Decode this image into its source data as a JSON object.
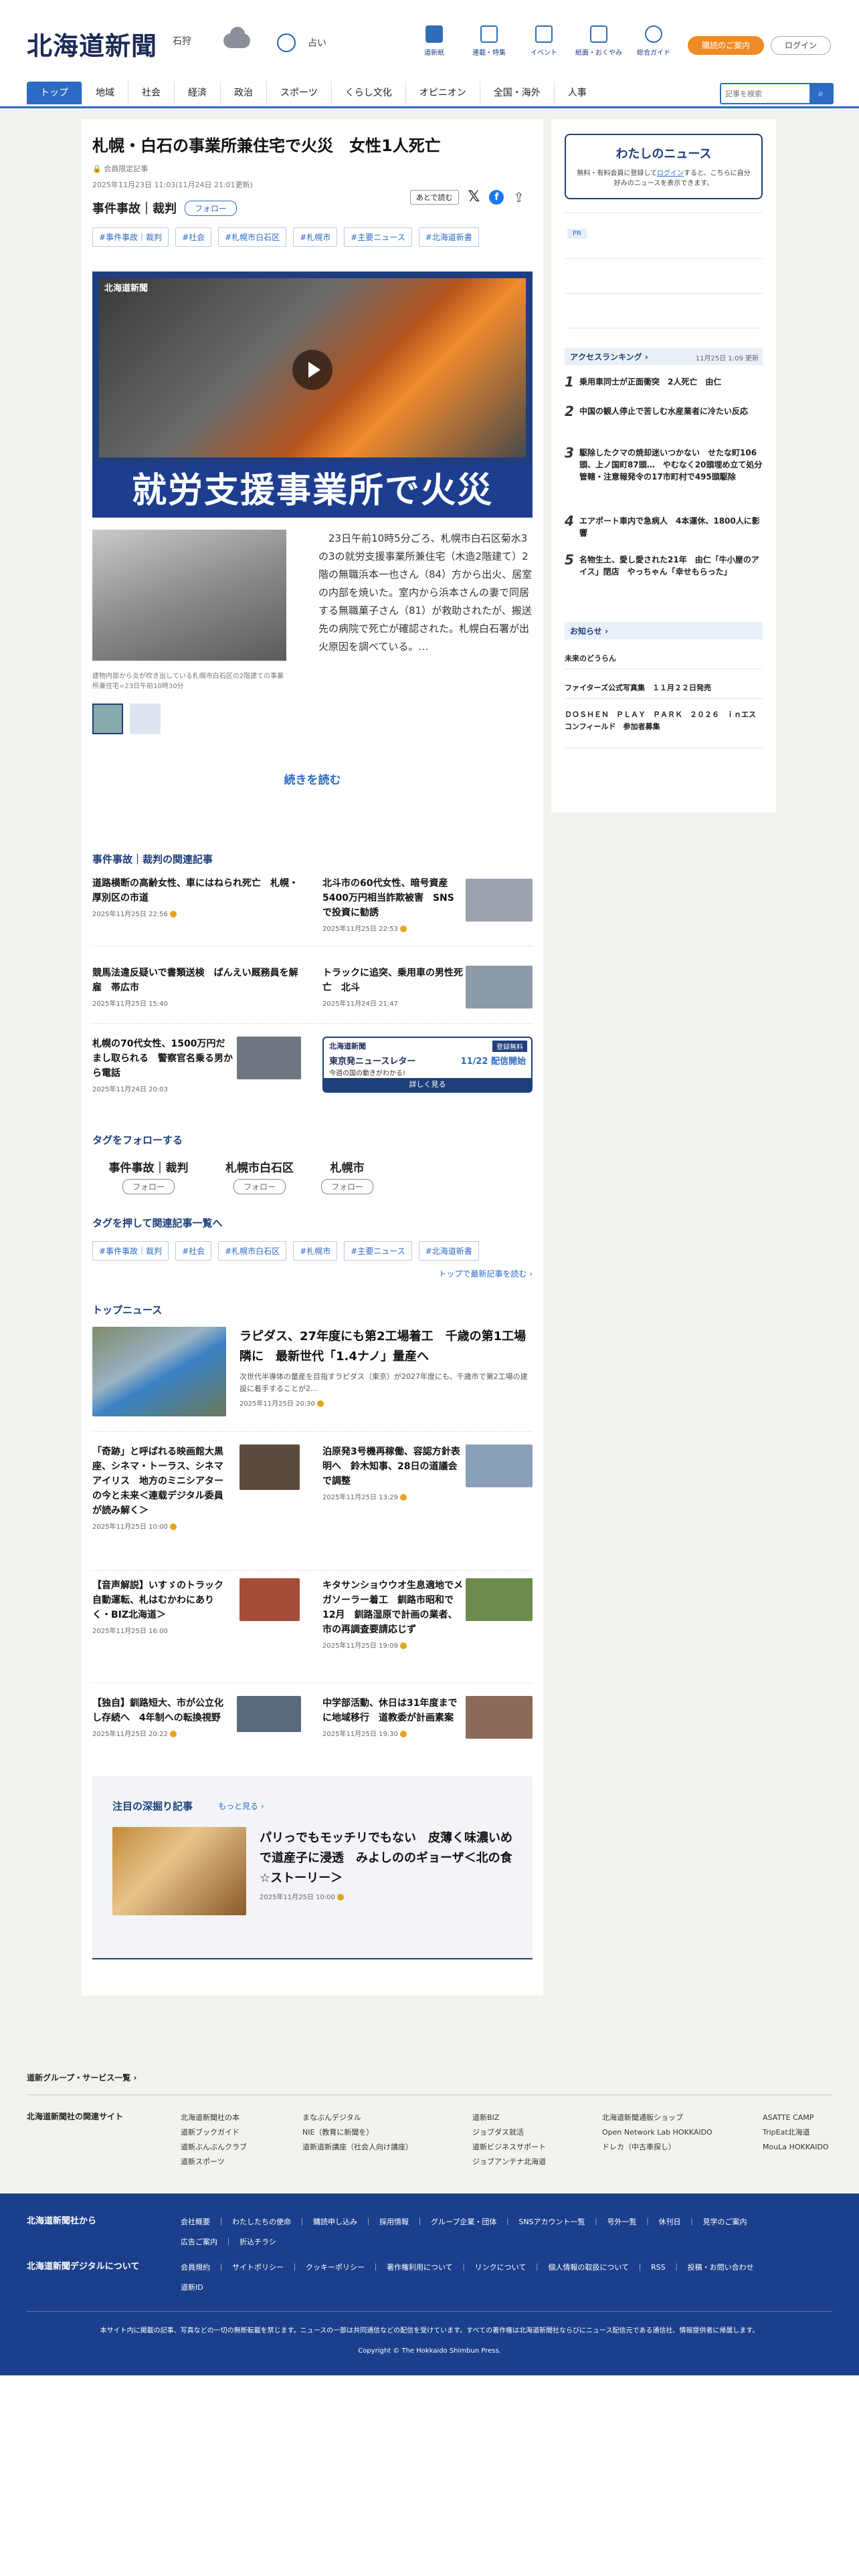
{
  "header": {
    "logo": "北海道新聞",
    "region": "石狩",
    "weather_label": "占い",
    "icons": [
      {
        "icon": "book-icon",
        "label": "道新紙"
      },
      {
        "icon": "flag-icon",
        "label": "連載・特集"
      },
      {
        "icon": "calendar-icon",
        "label": "イベント"
      },
      {
        "icon": "newspaper-icon",
        "label": "紙面・おくやみ"
      },
      {
        "icon": "help-icon",
        "label": "総合ガイド"
      }
    ],
    "subscribe": "購読のご案内",
    "login": "ログイン"
  },
  "nav": {
    "items": [
      "トップ",
      "地域",
      "社会",
      "経済",
      "政治",
      "スポーツ",
      "くらし文化",
      "オピニオン",
      "全国・海外",
      "人事"
    ],
    "search_placeholder": "記事を検索"
  },
  "article": {
    "title": "札幌・白石の事業所兼住宅で火災　女性1人死亡",
    "badge": "会員限定記事",
    "date": "2025年11月23日 11:03(11月24日 21:01更新)",
    "category": "事件事故｜裁判",
    "follow": "フォロー",
    "read_later": "あとで読む",
    "tags": [
      "#事件事故｜裁判",
      "#社会",
      "#札幌市白石区",
      "#札幌市",
      "#主要ニュース",
      "#北海道新書"
    ],
    "video_logo": "北海道新聞",
    "video_caption": "就労支援事業所で火災",
    "photo_caption": "建物内部から炎が吹き出している札幌市白石区の2階建ての事業所兼住宅=23日午前10時30分",
    "body": "23日午前10時5分ごろ、札幌市白石区菊水3の3の就労支援事業所兼住宅（木造2階建て）2階の無職浜本一也さん（84）方から出火、居室の内部を焼いた。室内から浜本さんの妻で同居する無職菓子さん（81）が救助されたが、搬送先の病院で死亡が確認された。札幌白石署が出火原因を調べている。…",
    "continue": "続きを読む"
  },
  "related": {
    "heading": "事件事故｜裁判の関連記事",
    "items": [
      {
        "t": "道路横断の高齢女性、車にはねられ死亡　札幌・厚別区の市道",
        "d": "2025年11月25日 22:56"
      },
      {
        "t": "北斗市の60代女性、暗号資産5400万円相当詐欺被害　SNSで投資に勧誘",
        "d": "2025年11月25日 22:53"
      },
      {
        "t": "競馬法違反疑いで書類送検　ばんえい厩務員を解雇　帯広市",
        "d": "2025年11月25日 15:40"
      },
      {
        "t": "トラックに追突、乗用車の男性死亡　北斗",
        "d": "2025年11月24日 21:47"
      },
      {
        "t": "札幌の70代女性、1500万円だまし取られる　警察官名乗る男から電話",
        "d": "2025年11月24日 20:03"
      }
    ],
    "promo": {
      "logo": "北海道新聞",
      "badge": "登録無料",
      "line1": "東京発ニュースレター",
      "line2": "11/22 配信開始",
      "line3": "今週の国の動きがわかる!",
      "cta": "詳しく見る"
    }
  },
  "follow_tags": {
    "heading": "タグをフォローする",
    "items": [
      "事件事故｜裁判",
      "札幌市白石区",
      "札幌市"
    ],
    "button": "フォロー"
  },
  "tag_search": {
    "heading": "タグを押して関連記事一覧へ",
    "tags": [
      "#事件事故｜裁判",
      "#社会",
      "#札幌市白石区",
      "#札幌市",
      "#主要ニュース",
      "#北海道新書"
    ],
    "more": "トップで最新記事を読む"
  },
  "top": {
    "heading": "トップニュース",
    "lead": {
      "t": "ラピダス、27年度にも第2工場着工　千歳の第1工場隣に　最新世代「1.4ナノ」量産へ",
      "s": "次世代半導体の量産を目指すラピダス（東京）が2027年度にも、千歳市で第2工場の建設に着手することが2…",
      "d": "2025年11月25日 20:30"
    },
    "items": [
      {
        "t": "「奇跡」と呼ばれる映画館大黒座、シネマ・トーラス、シネマアイリス　地方のミニシアターの今と未来＜連载デジタル委員が読み解く＞",
        "d": "2025年11月25日 10:00"
      },
      {
        "t": "泊原発3号機再稼働、容認方針表明へ　鈴木知事、28日の道議会で調整",
        "d": "2025年11月25日 13:29"
      },
      {
        "t": "【音声解説】いすゞのトラック自動運転、札はむかわにありく・BIZ北海道＞",
        "d": "2025年11月25日 16:00"
      },
      {
        "t": "キタサンショウウオ生息適地でメガソーラー着工　釧路市昭和で12月　釧路湿原で計画の業者、市の再調査要請応じず",
        "d": "2025年11月25日 19:09"
      },
      {
        "t": "【独自】釧路短大、市が公立化し存続へ　4年制への転換視野",
        "d": "2025年11月25日 20:22"
      },
      {
        "t": "中学部活動、休日は31年度までに地域移行　道教委が計画素案",
        "d": "2025年11月25日 19:30"
      }
    ]
  },
  "deep": {
    "heading": "注目の深掘り記事",
    "more": "もっと見る",
    "t": "パリっでもモッチリでもない　皮薄く味濃いめで道産子に浸透　みよしののギョーザ＜北の食☆ストーリー＞",
    "d": "2025年11月25日 10:00"
  },
  "side": {
    "mynews_title": "わたしのニュース",
    "mynews_text": "無料・有料会員に登録して",
    "mynews_login": "ログイン",
    "mynews_text2": "すると、こちらに自分好みのニュースを表示できます。",
    "pr": "PR",
    "ranking_title": "アクセスランキング",
    "ranking_time": "11月25日 1:09 更新",
    "ranking": [
      "乗用車同士が正面衝突　2人死亡　由仁",
      "中国の観人停止で苦しむ水産業者に冷たい反応",
      "駆除したクマの焼却迷いつかない　せたな町106頭、上ノ国町87頭…　やむなく20頭埋め立て処分　管轄・注意報発令の17市町村で495頭駆除",
      "エアポート車内で急病人　4本運休、1800人に影響",
      "名物生土、愛し愛された21年　由仁「牛小屋のアイス」閉店　やっちゃん「幸せもらった」"
    ],
    "notice_title": "お知らせ",
    "notices": [
      "未来のどうらん",
      "ファイターズ公式写真集　１１月２２日発売",
      "ＤＯＳＨＥＮ　ＰＬＡＹ　ＰＡＲＫ　２０２６　ｉｎエスコンフィールド　参加者募集"
    ]
  },
  "footer": {
    "group_label": "道新グループ・サービス一覧",
    "related_label": "北海道新聞社の関連サイト",
    "sites": [
      [
        "北海道新聞社の本",
        "道新ブックガイド",
        "道新ぶんぶんクラブ",
        "道新スポーツ"
      ],
      [
        "まなぶんデジタル",
        "NIE（教育に新聞を）",
        "道新道新講座（社会人向け講座）"
      ],
      [
        "道新BIZ",
        "ジョブダス就活",
        "道新ビジネスサポート",
        "ジョブアンテナ北海道"
      ],
      [
        "北海道新聞通販ショップ",
        "Open Network Lab HOKKAIDO",
        "ドレカ（中古車探し）"
      ],
      [
        "ASATTE CAMP",
        "TripEat北海道",
        "MouLa HOKKAIDO"
      ]
    ],
    "from_label": "北海道新聞社から",
    "from_links": [
      "会社概要",
      "わたしたちの使命",
      "購読申し込み",
      "採用情報",
      "グループ企業・団体",
      "SNSアカウント一覧",
      "号外一覧",
      "休刊日",
      "見学のご案内",
      "広告ご案内",
      "折込チラシ"
    ],
    "digital_label": "北海道新聞デジタルについて",
    "digital_links": [
      "会員規約",
      "サイトポリシー",
      "クッキーポリシー",
      "著作権利用について",
      "リンクについて",
      "個人情報の取扱について",
      "RSS",
      "投稿・お問い合わせ",
      "道新ID"
    ],
    "notice": "本サイト内に掲載の記事、写真などの一切の無断転載を禁じます。ニュースの一部は共同通信などの配信を受けています。すべての著作権は北海道新聞社ならびにニュース配信元である通信社、情報提供者に帰属します。",
    "copyright": "Copyright © The Hokkaido Shimbun Press."
  },
  "colors": {
    "brand": "#1c2a57",
    "accent": "#2c6cc4",
    "orange": "#f08a24",
    "footer": "#1b3f8c"
  }
}
